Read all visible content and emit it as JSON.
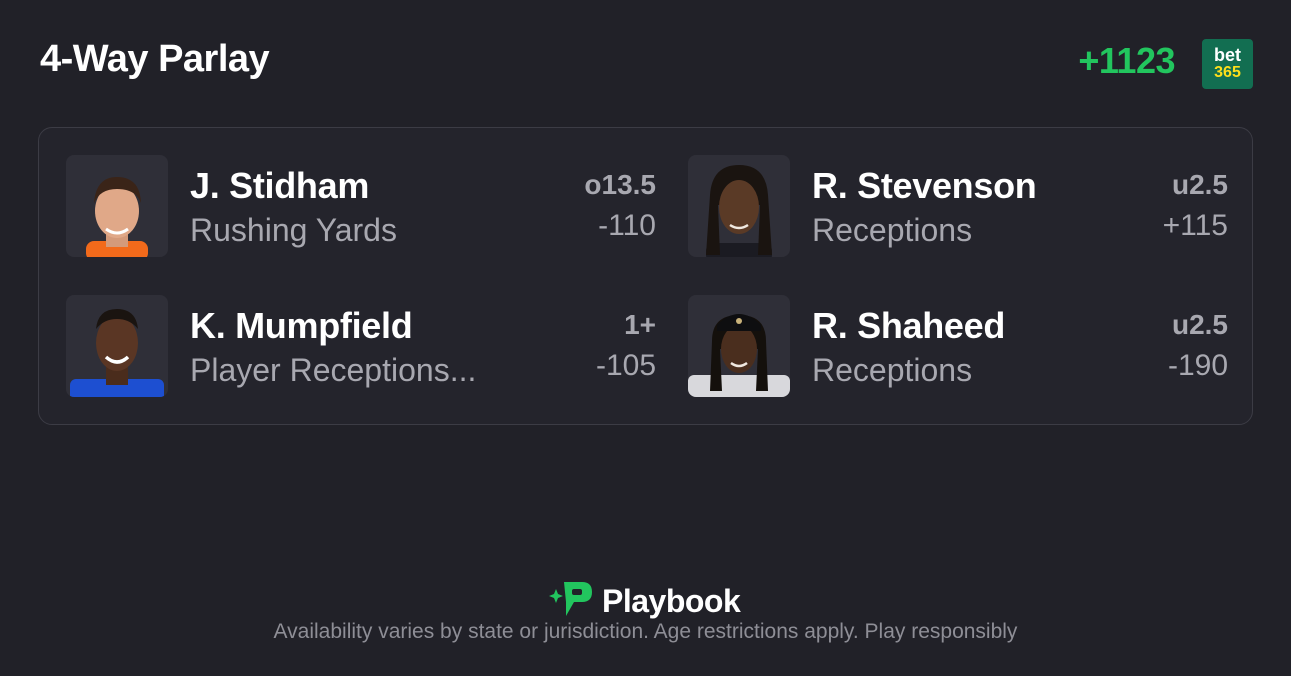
{
  "header": {
    "title": "4-Way Parlay",
    "total_odds": "+1123",
    "sportsbook": {
      "line1": "bet",
      "line2": "365",
      "bg_color": "#126e51",
      "accent_color": "#ffdf1b"
    }
  },
  "legs": [
    {
      "player": "J. Stidham",
      "market": "Rushing Yards",
      "line": "o13.5",
      "odds": "-110",
      "jersey_color": "#f26a1b"
    },
    {
      "player": "R. Stevenson",
      "market": "Receptions",
      "line": "u2.5",
      "odds": "+115",
      "jersey_color": "#1b1b22"
    },
    {
      "player": "K. Mumpfield",
      "market": "Player Receptions...",
      "line": "1+",
      "odds": "-105",
      "jersey_color": "#1d4fd1"
    },
    {
      "player": "R. Shaheed",
      "market": "Receptions",
      "line": "u2.5",
      "odds": "-190",
      "jersey_color": "#d8d8dc"
    }
  ],
  "footer": {
    "brand": "Playbook",
    "disclaimer": "Availability varies by state or jurisdiction. Age restrictions apply. Play responsibly",
    "brand_color": "#22c55e"
  },
  "colors": {
    "background": "#212128",
    "card": "#24242c",
    "positive": "#22c55e",
    "muted": "#a8a8b0"
  }
}
